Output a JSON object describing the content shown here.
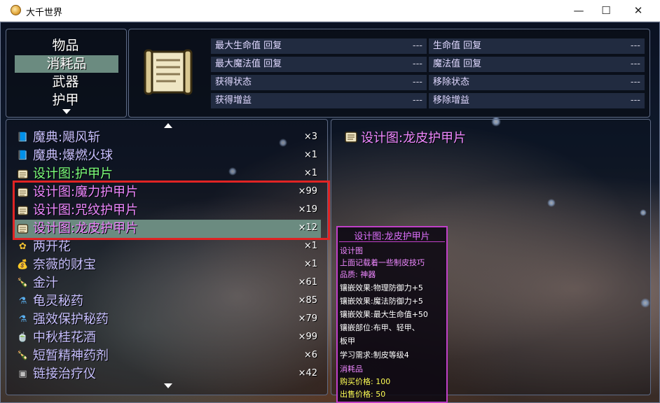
{
  "window": {
    "title": "大千世界",
    "minimize": "—",
    "maximize": "☐",
    "close": "✕"
  },
  "categories": [
    {
      "label": "物品",
      "selected": false
    },
    {
      "label": "消耗品",
      "selected": true
    },
    {
      "label": "武器",
      "selected": false
    },
    {
      "label": "护甲",
      "selected": false
    }
  ],
  "stats": {
    "left": [
      {
        "label": "最大生命值 回复",
        "value": "---"
      },
      {
        "label": "最大魔法值 回复",
        "value": "---"
      },
      {
        "label": "获得状态",
        "value": "---"
      },
      {
        "label": "获得增益",
        "value": "---"
      }
    ],
    "right": [
      {
        "label": "生命值 回复",
        "value": "---"
      },
      {
        "label": "魔法值 回复",
        "value": "---"
      },
      {
        "label": "移除状态",
        "value": "---"
      },
      {
        "label": "移除增益",
        "value": "---"
      }
    ]
  },
  "items": [
    {
      "name": "魔典:飓风斩",
      "count": "×3",
      "icon": "book-icon",
      "color": "#c8c0ff"
    },
    {
      "name": "魔典:爆燃火球",
      "count": "×1",
      "icon": "book-icon",
      "color": "#c8c0ff"
    },
    {
      "name": "设计图:护甲片",
      "count": "×1",
      "icon": "scroll-icon",
      "color": "#7cff7c"
    },
    {
      "name": "设计图:魔力护甲片",
      "count": "×99",
      "icon": "scroll-icon",
      "color": "#ee88ff"
    },
    {
      "name": "设计图:咒纹护甲片",
      "count": "×19",
      "icon": "scroll-icon",
      "color": "#ee88ff"
    },
    {
      "name": "设计图:龙皮护甲片",
      "count": "×12",
      "icon": "scroll-icon",
      "color": "#ee88ff"
    },
    {
      "name": "两开花",
      "count": "×1",
      "icon": "flower-icon",
      "color": "#c8c0ff"
    },
    {
      "name": "奈薇的财宝",
      "count": "×1",
      "icon": "money-bag-icon",
      "color": "#c8c0ff"
    },
    {
      "name": "金汁",
      "count": "×61",
      "icon": "bottle-icon",
      "color": "#c8c0ff"
    },
    {
      "name": "龟灵秘药",
      "count": "×85",
      "icon": "potion-icon",
      "color": "#c8c0ff"
    },
    {
      "name": "强效保护秘药",
      "count": "×79",
      "icon": "potion-icon",
      "color": "#c8c0ff"
    },
    {
      "name": "中秋桂花酒",
      "count": "×99",
      "icon": "bowl-icon",
      "color": "#c8c0ff"
    },
    {
      "name": "短暂精神药剂",
      "count": "×6",
      "icon": "bottle-icon",
      "color": "#c8c0ff"
    },
    {
      "name": "链接治疗仪",
      "count": "×42",
      "icon": "device-icon",
      "color": "#c8c0ff"
    }
  ],
  "detail": {
    "title": "设计图:龙皮护甲片"
  },
  "tooltip": {
    "title": "设计图:龙皮护甲片",
    "type": "设计图",
    "desc": "上面记载着一些制皮技巧",
    "quality": "品质: 神器",
    "effects": [
      "镶嵌效果:物理防御力+5",
      "镶嵌效果:魔法防御力+5",
      "镶嵌效果:最大生命值+50",
      "镶嵌部位:布甲、轻甲、",
      "板甲",
      "学习需求:制皮等级4"
    ],
    "category": "消耗品",
    "buy": "购买价格: 100",
    "sell": "出售价格: 50"
  }
}
